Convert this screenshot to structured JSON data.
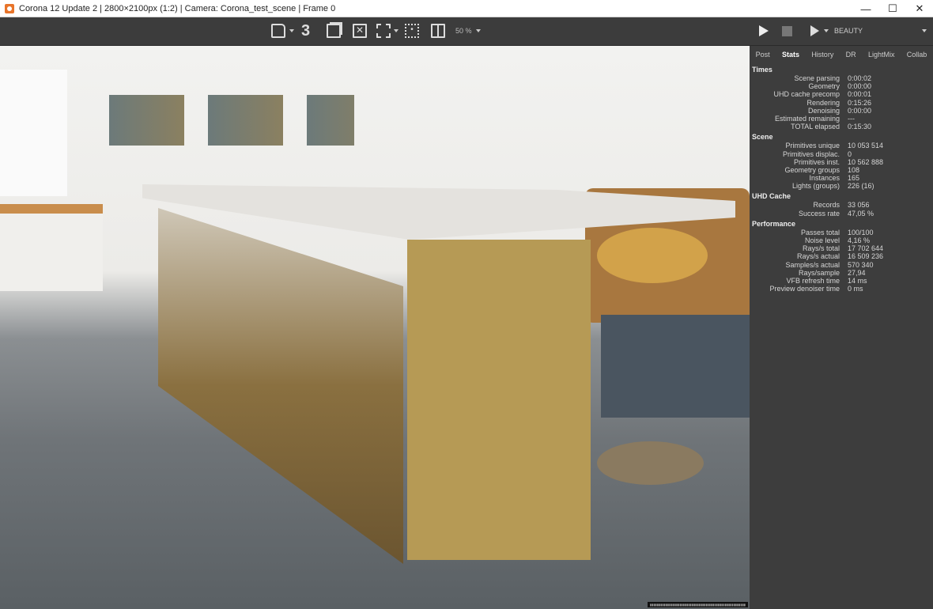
{
  "window": {
    "title": "Corona 12 Update 2 | 2800×2100px (1:2) | Camera: Corona_test_scene | Frame 0",
    "minimize": "—",
    "maximize": "☐",
    "close": "✕"
  },
  "toolbar": {
    "history_count": "3",
    "zoom": "50 %",
    "render_pass": "BEAUTY"
  },
  "panel": {
    "tabs": [
      "Post",
      "Stats",
      "History",
      "DR",
      "LightMix",
      "Collab"
    ],
    "active_tab": "Stats",
    "sections": [
      {
        "title": "Times",
        "rows": [
          [
            "Scene parsing",
            "0:00:02"
          ],
          [
            "Geometry",
            "0:00:00"
          ],
          [
            "UHD cache precomp",
            "0:00:01"
          ],
          [
            "Rendering",
            "0:15:26"
          ],
          [
            "Denoising",
            "0:00:00"
          ],
          [
            "Estimated remaining",
            "---"
          ],
          [
            "TOTAL elapsed",
            "0:15:30"
          ]
        ]
      },
      {
        "title": "Scene",
        "rows": [
          [
            "Primitives unique",
            "10 053 514"
          ],
          [
            "Primitives displac.",
            "0"
          ],
          [
            "Primitives inst.",
            "10 562 888"
          ],
          [
            "Geometry groups",
            "108"
          ],
          [
            "Instances",
            "165"
          ],
          [
            "Lights (groups)",
            "226 (16)"
          ]
        ]
      },
      {
        "title": "UHD Cache",
        "rows": [
          [
            "Records",
            "33 056"
          ],
          [
            "Success rate",
            "47,05 %"
          ]
        ]
      },
      {
        "title": "Performance",
        "rows": [
          [
            "Passes total",
            "100/100"
          ],
          [
            "Noise level",
            "4,16 %"
          ],
          [
            "Rays/s total",
            "17 702 644"
          ],
          [
            "Rays/s actual",
            "16 509 236"
          ],
          [
            "Samples/s actual",
            "570 340"
          ],
          [
            "Rays/sample",
            "27,94"
          ],
          [
            "VFB refresh time",
            "14 ms"
          ],
          [
            "Preview denoiser time",
            "0 ms"
          ]
        ]
      }
    ]
  }
}
